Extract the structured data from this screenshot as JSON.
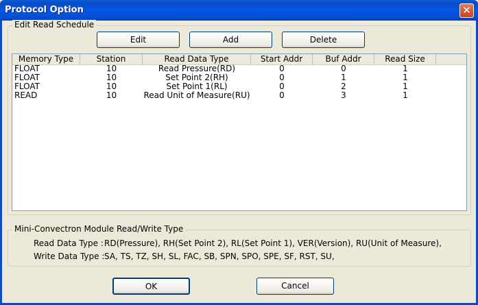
{
  "window": {
    "title": "Protocol Option",
    "close_glyph": "✕"
  },
  "schedule": {
    "group_label": "Edit Read Schedule",
    "buttons": {
      "edit": "Edit",
      "add": "Add",
      "delete": "Delete"
    },
    "columns": [
      "Memory Type",
      "Station",
      "Read Data Type",
      "Start Addr",
      "Buf Addr",
      "Read Size"
    ],
    "rows": [
      [
        "FLOAT",
        "10",
        "Read Pressure(RD)",
        "0",
        "0",
        "1"
      ],
      [
        "FLOAT",
        "10",
        "Set Point 2(RH)",
        "0",
        "1",
        "1"
      ],
      [
        "FLOAT",
        "10",
        "Set Point 1(RL)",
        "0",
        "2",
        "1"
      ],
      [
        "READ",
        "10",
        "Read Unit of Measure(RU)",
        "0",
        "3",
        "1"
      ]
    ]
  },
  "module_info": {
    "group_label": "Mini-Convectron Module Read/Write Type",
    "read_label": "Read Data Type :",
    "read_value": "RD(Pressure), RH(Set Point 2), RL(Set Point 1), VER(Version), RU(Unit of Measure),",
    "write_label": "Write Data Type :",
    "write_value": "SA, TS, TZ, SH, SL, FAC, SB, SPN, SPO, SPE, SF, RST, SU,"
  },
  "footer": {
    "ok": "OK",
    "cancel": "Cancel"
  }
}
